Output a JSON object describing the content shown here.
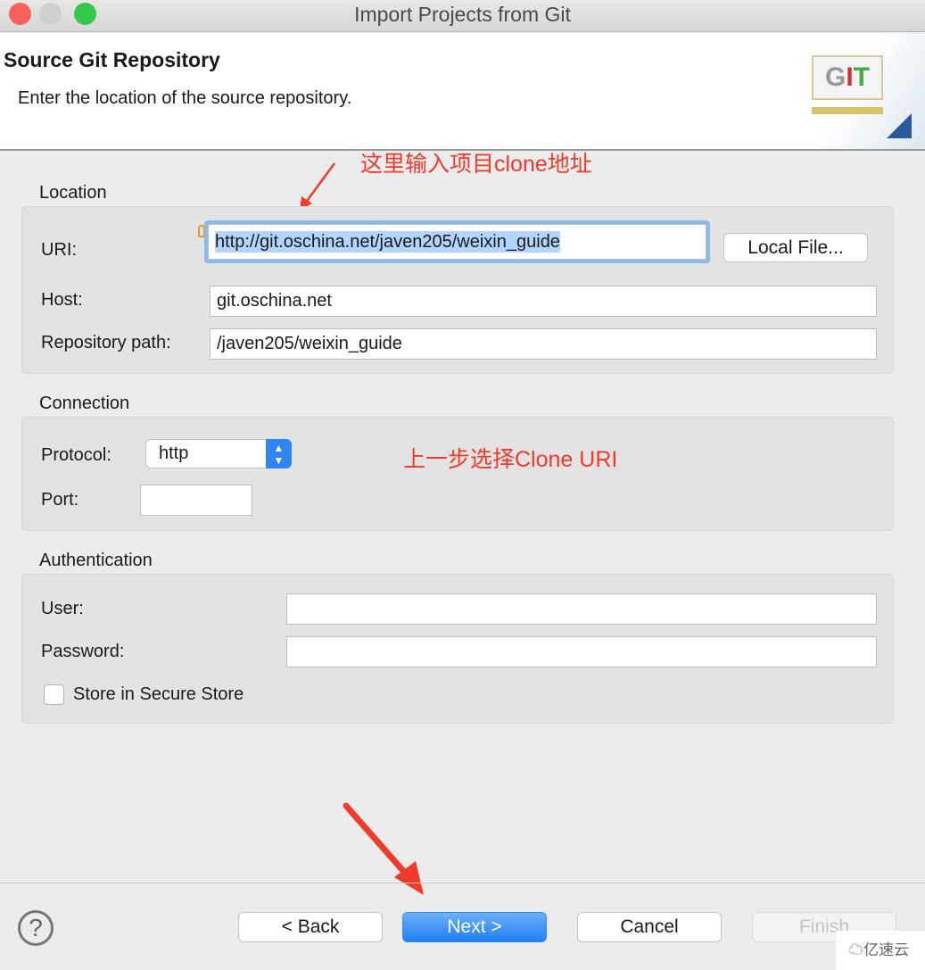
{
  "window": {
    "title": "Import Projects from Git"
  },
  "header": {
    "title": "Source Git Repository",
    "subtitle": "Enter the location of the source repository.",
    "logo_text": "GIT"
  },
  "location": {
    "label": "Location",
    "uri_label": "URI:",
    "uri_value": "http://git.oschina.net/javen205/weixin_guide",
    "local_file_button": "Local File...",
    "host_label": "Host:",
    "host_value": "git.oschina.net",
    "repo_label": "Repository path:",
    "repo_value": "/javen205/weixin_guide"
  },
  "connection": {
    "label": "Connection",
    "protocol_label": "Protocol:",
    "protocol_value": "http",
    "port_label": "Port:",
    "port_value": ""
  },
  "auth": {
    "label": "Authentication",
    "user_label": "User:",
    "user_value": "",
    "password_label": "Password:",
    "password_value": "",
    "store_label": "Store in Secure Store",
    "store_checked": false
  },
  "annotations": {
    "uri_note": "这里输入项目clone地址",
    "protocol_note": "上一步选择Clone URI",
    "color": "#f03a2a"
  },
  "footer": {
    "back": "< Back",
    "next": "Next >",
    "cancel": "Cancel",
    "finish": "Finish"
  },
  "watermark": "亿速云",
  "colors": {
    "accent": "#2f86f0",
    "selection": "#b3d4fc"
  }
}
